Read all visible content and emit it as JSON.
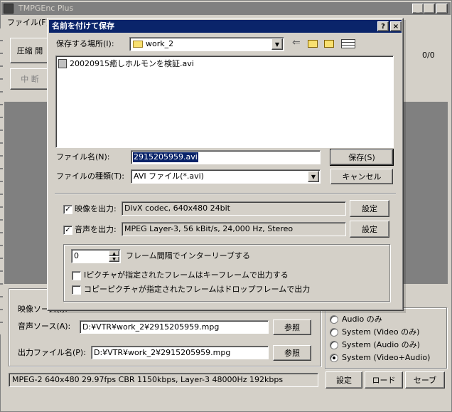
{
  "main_window": {
    "title": "TMPGEnc Plus",
    "menu_file": "ファイル(F)",
    "encode_button": "圧縮 開",
    "stop_button": "中 断",
    "progress": "0/0",
    "video_source_label": "映像ソース(I):",
    "audio_source_label": "音声ソース(A):",
    "audio_source_value": "D:¥VTR¥work_2¥2915205959.mpg",
    "output_file_label": "出力ファイル名(P):",
    "output_file_value": "D:¥VTR¥work_2¥2915205959.mpg",
    "browse_label": "参照",
    "radio_options": [
      "Audio のみ",
      "System (Video のみ)",
      "System (Audio のみ)",
      "System (Video+Audio)"
    ],
    "radio_selected": 3,
    "status_text": "MPEG-2 640x480 29.97fps CBR 1150kbps,  Layer-3 48000Hz 192kbps",
    "settings_button": "設定",
    "load_button": "ロード",
    "save_button": "セーブ"
  },
  "dialog": {
    "title": "名前を付けて保存",
    "help_button": "?",
    "close_button": "×",
    "save_in_label": "保存する場所(I):",
    "save_in_value": "work_2",
    "files": [
      "20020915癒しホルモンを検証.avi"
    ],
    "filename_label": "ファイル名(N):",
    "filename_value": "2915205959.avi",
    "filetype_label": "ファイルの種類(T):",
    "filetype_value": "AVI ファイル(*.avi)",
    "save_button": "保存(S)",
    "cancel_button": "キャンセル",
    "video_output_label": "映像を出力:",
    "video_output_checked": true,
    "video_output_value": "DivX codec, 640x480 24bit",
    "audio_output_label": "音声を出力:",
    "audio_output_checked": true,
    "audio_output_value": "MPEG Layer-3, 56 kBit/s, 24,000 Hz, Stereo",
    "settings_button": "設定",
    "interleave_value": "0",
    "interleave_label": "フレーム間隔でインターリーブする",
    "ipic_label": "Iピクチャが指定されたフレームはキーフレームで出力する",
    "ipic_checked": false,
    "copy_label": "コピーピクチャが指定されたフレームはドロップフレームで出力",
    "copy_checked": false
  }
}
